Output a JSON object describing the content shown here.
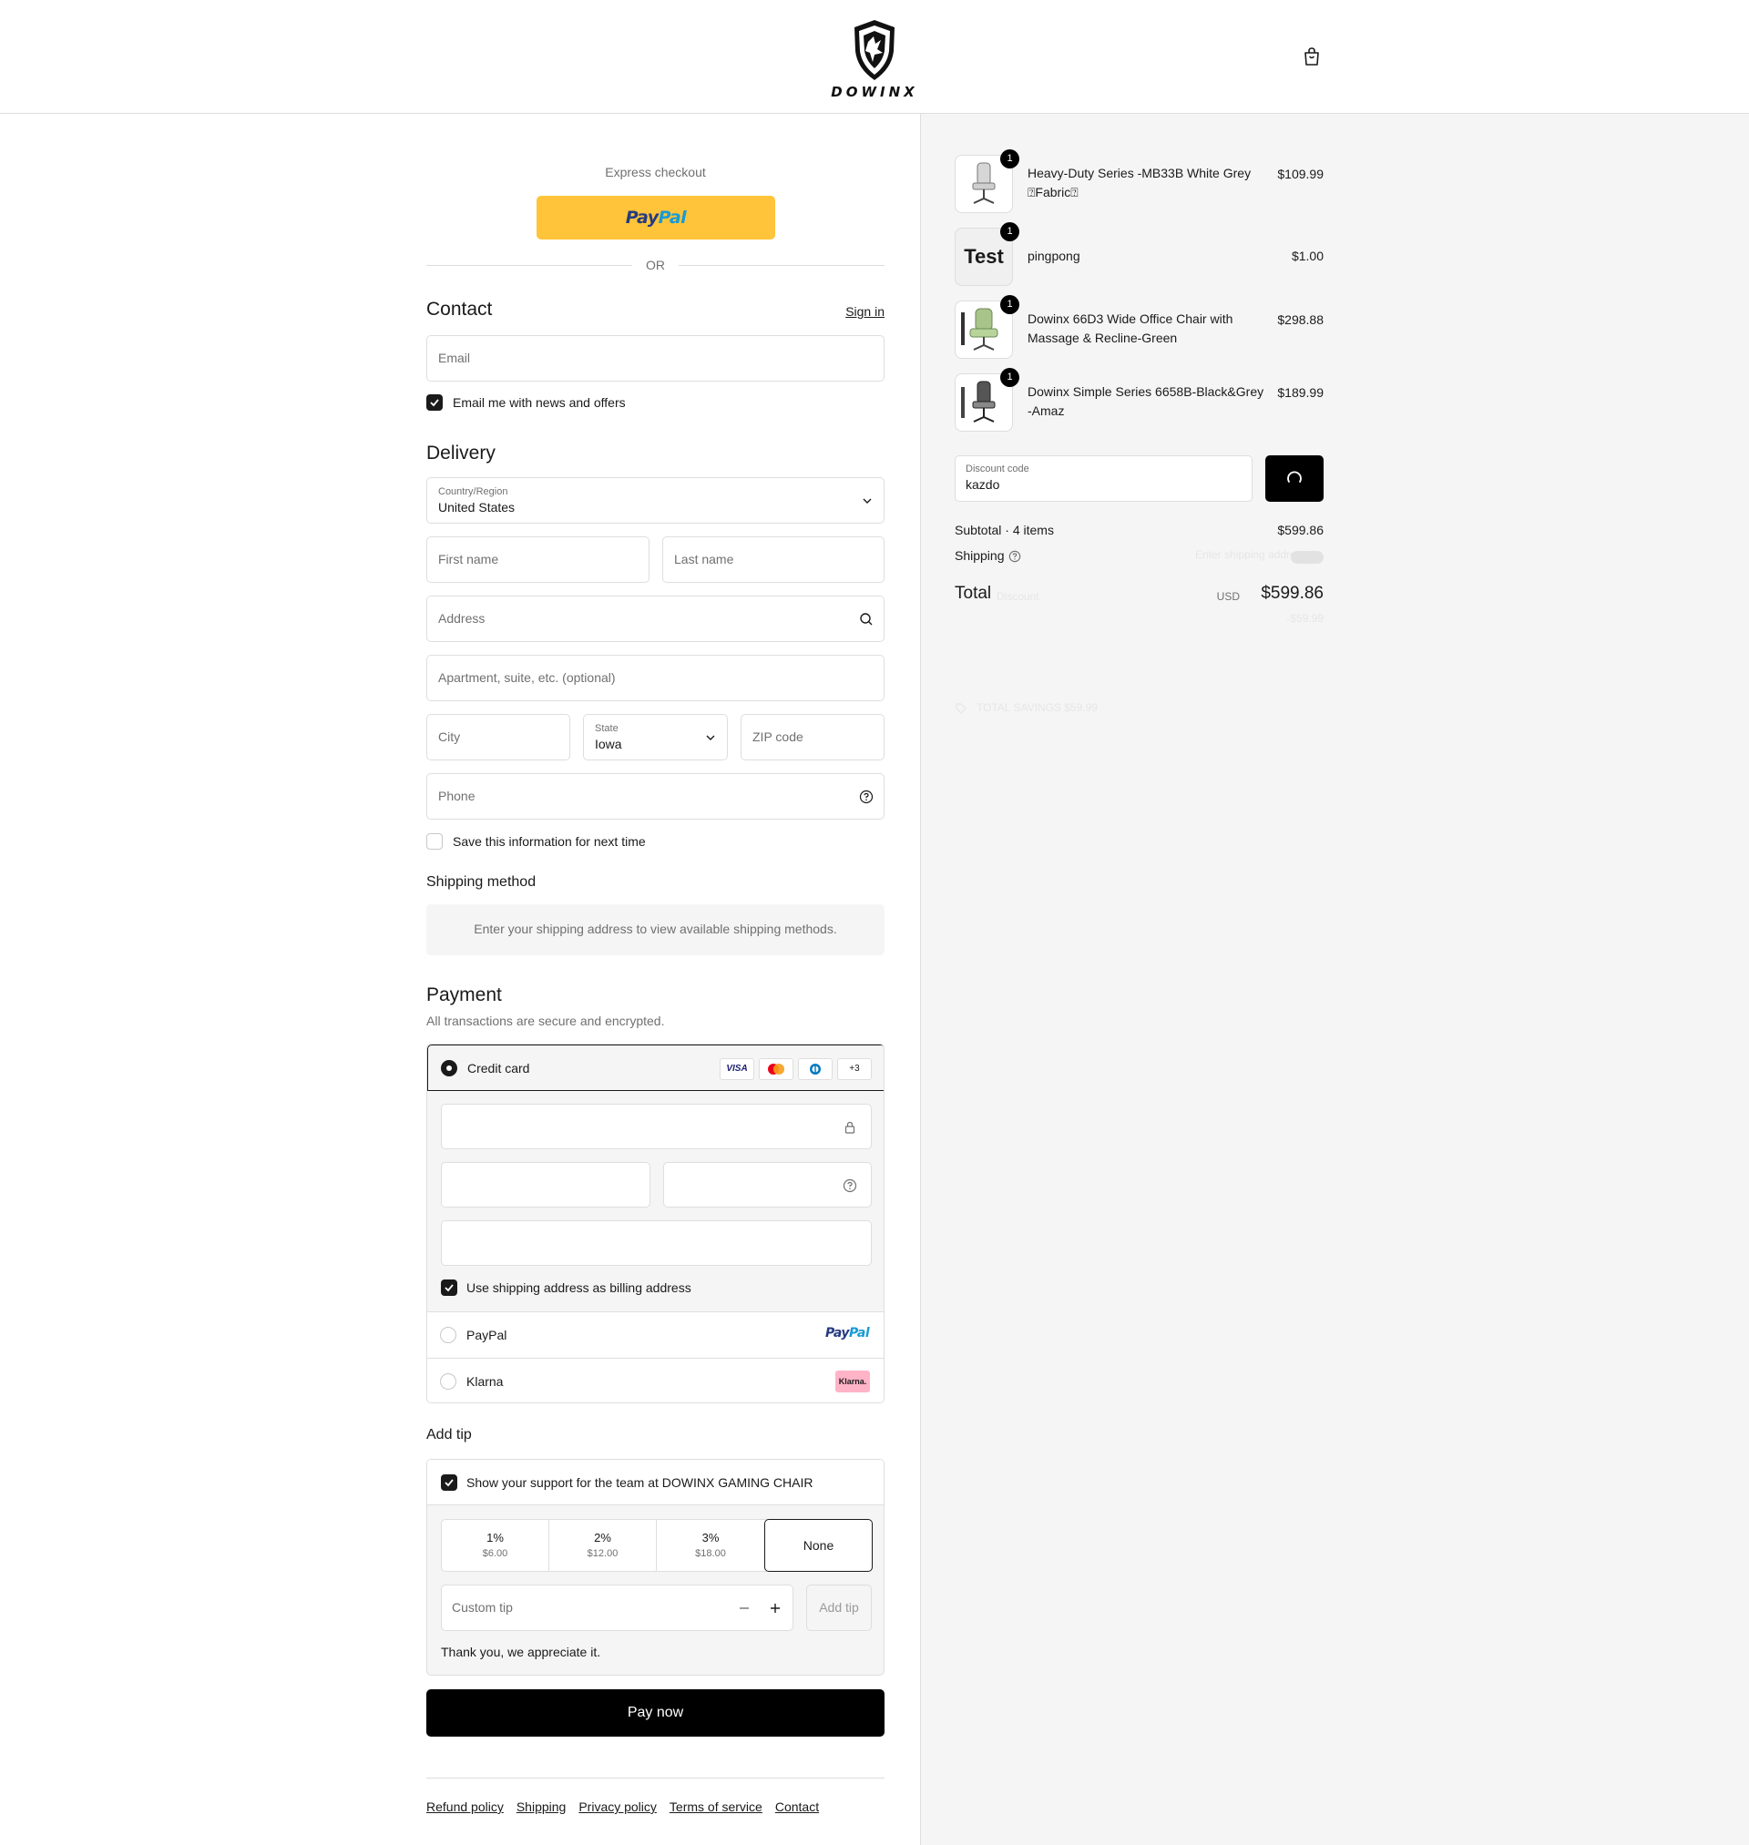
{
  "header": {
    "brand": "DOWINX",
    "cart_icon": "shopping-bag-icon"
  },
  "express": {
    "label": "Express checkout",
    "paypal_part1": "Pay",
    "paypal_part2": "Pal",
    "or": "OR"
  },
  "contact": {
    "title": "Contact",
    "sign_in": "Sign in",
    "email_placeholder": "Email",
    "news_label": "Email me with news and offers",
    "news_checked": true
  },
  "delivery": {
    "title": "Delivery",
    "country_label": "Country/Region",
    "country_value": "United States",
    "first_name_placeholder": "First name",
    "last_name_placeholder": "Last name",
    "address_placeholder": "Address",
    "apartment_placeholder": "Apartment, suite, etc. (optional)",
    "city_placeholder": "City",
    "state_label": "State",
    "state_value": "Iowa",
    "zip_placeholder": "ZIP code",
    "phone_placeholder": "Phone",
    "save_label": "Save this information for next time",
    "save_checked": false
  },
  "shipping_method": {
    "title": "Shipping method",
    "info": "Enter your shipping address to view available shipping methods."
  },
  "payment": {
    "title": "Payment",
    "subtitle": "All transactions are secure and encrypted.",
    "credit_card_label": "Credit card",
    "card_brands": [
      "VISA",
      "+3"
    ],
    "billing_label": "Use shipping address as billing address",
    "billing_checked": true,
    "paypal_label": "PayPal",
    "klarna_label": "Klarna",
    "klarna_badge": "Klarna."
  },
  "tip": {
    "title": "Add tip",
    "support_label": "Show your support for the team at DOWINX GAMING CHAIR",
    "support_checked": true,
    "options": [
      {
        "pct": "1%",
        "amount": "$6.00"
      },
      {
        "pct": "2%",
        "amount": "$12.00"
      },
      {
        "pct": "3%",
        "amount": "$18.00"
      }
    ],
    "none_label": "None",
    "custom_placeholder": "Custom tip",
    "add_tip_label": "Add tip",
    "thanks": "Thank you, we appreciate it."
  },
  "pay_now": "Pay now",
  "footer_links": [
    "Refund policy",
    "Shipping",
    "Privacy policy",
    "Terms of service",
    "Contact"
  ],
  "order": {
    "items": [
      {
        "name": "Heavy-Duty Series -MB33B White Grey ⍰Fabric⍰",
        "price": "$109.99",
        "qty": "1"
      },
      {
        "name": "pingpong",
        "price": "$1.00",
        "qty": "1",
        "thumb_text": "Test"
      },
      {
        "name": "Dowinx 66D3 Wide Office Chair with Massage & Recline-Green",
        "price": "$298.88",
        "qty": "1"
      },
      {
        "name": "Dowinx Simple Series 6658B-Black&Grey -Amaz",
        "price": "$189.99",
        "qty": "1"
      }
    ],
    "discount_label": "Discount code",
    "discount_value": "kazdo",
    "subtotal_label": "Subtotal · 4 items",
    "subtotal_value": "$599.86",
    "shipping_label": "Shipping",
    "shipping_value": "Enter shipping address",
    "total_label": "Total",
    "total_currency": "USD",
    "total_value": "$599.86",
    "faded_discount": "Discount",
    "faded_discount_value": "-$59.99",
    "faded_savings": "TOTAL SAVINGS $59.99"
  }
}
